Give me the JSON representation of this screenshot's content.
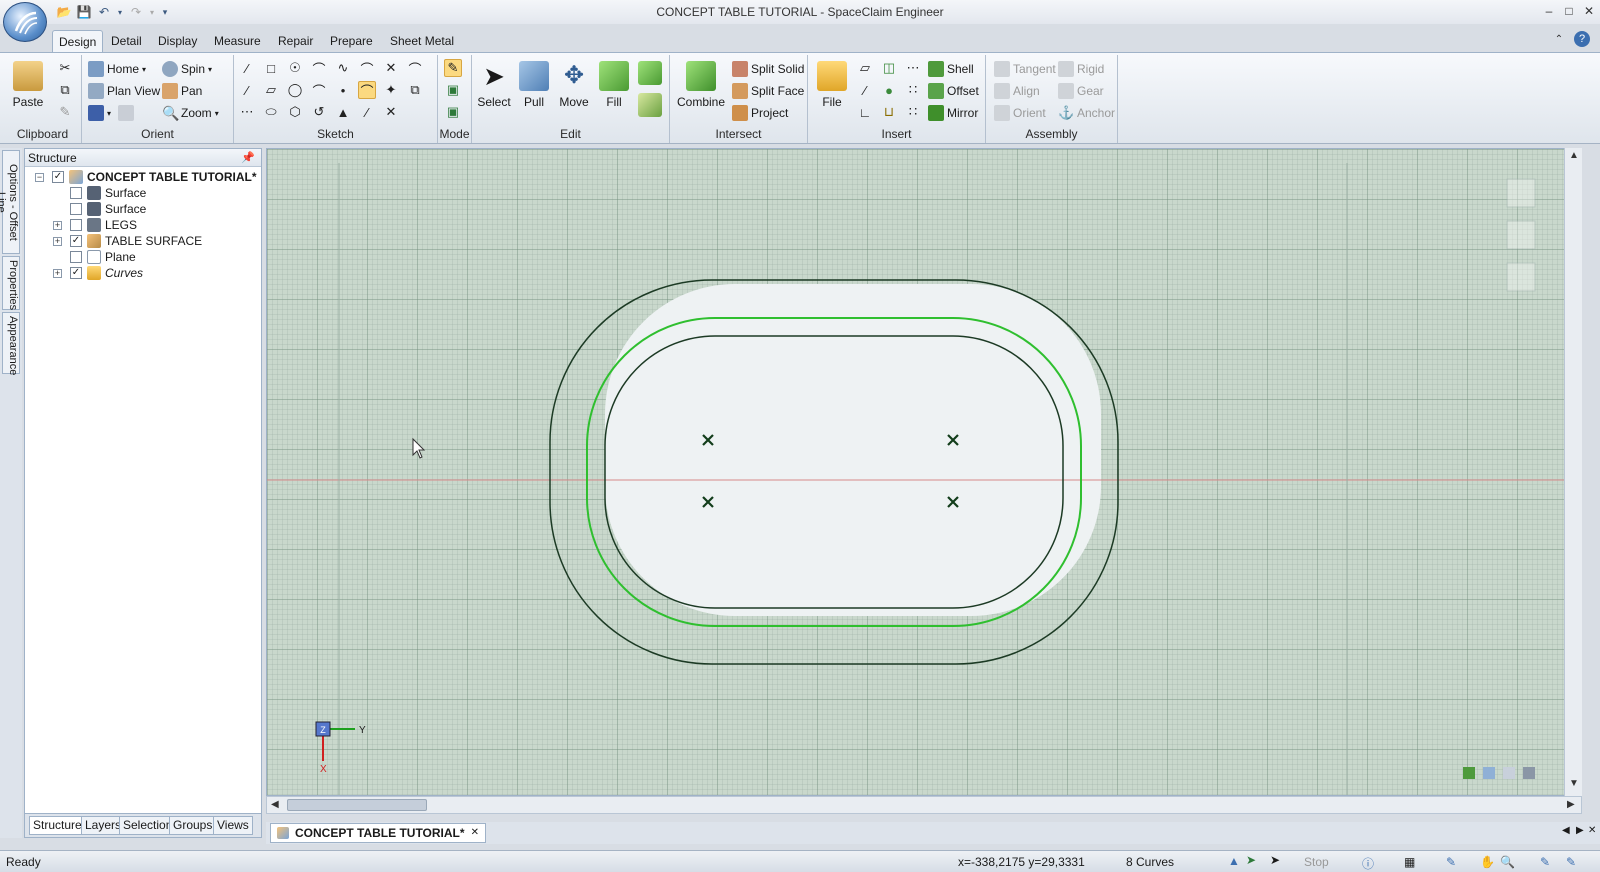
{
  "window": {
    "title": "CONCEPT TABLE TUTORIAL - SpaceClaim Engineer",
    "minimize": "–",
    "maximize": "□",
    "close": "✕"
  },
  "ribbon_tabs": [
    "Design",
    "Detail",
    "Display",
    "Measure",
    "Repair",
    "Prepare",
    "Sheet Metal"
  ],
  "ribbon": {
    "clipboard": {
      "label": "Clipboard",
      "paste": "Paste"
    },
    "orient": {
      "label": "Orient",
      "home": "Home",
      "spin": "Spin",
      "plan_view": "Plan View",
      "pan": "Pan",
      "zoom": "Zoom"
    },
    "sketch": {
      "label": "Sketch"
    },
    "mode": {
      "label": "Mode"
    },
    "edit": {
      "label": "Edit",
      "select": "Select",
      "pull": "Pull",
      "move": "Move",
      "fill": "Fill"
    },
    "intersect": {
      "label": "Intersect",
      "combine": "Combine",
      "split_solid": "Split Solid",
      "split_face": "Split Face",
      "project": "Project"
    },
    "insert": {
      "label": "Insert",
      "file": "File",
      "shell": "Shell",
      "offset": "Offset",
      "mirror": "Mirror"
    },
    "assembly": {
      "label": "Assembly",
      "tangent": "Tangent",
      "rigid": "Rigid",
      "align": "Align",
      "gear": "Gear",
      "orient": "Orient",
      "anchor": "Anchor"
    }
  },
  "side_tabs": [
    "Options - Offset Line",
    "Properties",
    "Appearance"
  ],
  "structure": {
    "title": "Structure",
    "tree": [
      {
        "label": "CONCEPT TABLE TUTORIAL*",
        "checked": true,
        "expander": "−",
        "bold": true
      },
      {
        "label": "Surface",
        "checked": false,
        "expander": ""
      },
      {
        "label": "Surface",
        "checked": false,
        "expander": ""
      },
      {
        "label": "LEGS",
        "checked": false,
        "expander": "+"
      },
      {
        "label": "TABLE SURFACE",
        "checked": true,
        "expander": "+"
      },
      {
        "label": "Plane",
        "checked": false,
        "expander": ""
      },
      {
        "label": "Curves",
        "checked": true,
        "expander": "+",
        "italic": true
      }
    ],
    "panel_tabs": [
      "Structure",
      "Layers",
      "Selection",
      "Groups",
      "Views"
    ]
  },
  "viewport": {
    "axis_z": "Z",
    "axis_y": "Y",
    "axis_x": "X"
  },
  "document_tab": {
    "label": "CONCEPT TABLE TUTORIAL*",
    "close": "✕"
  },
  "status": {
    "state": "Ready",
    "coords": "x=-338,2175  y=29,3331",
    "selection": "8 Curves",
    "stop": "Stop"
  },
  "colors": {
    "selected_curve": "#2fbf2f",
    "curve": "#1c3a24",
    "grid_bg": "#c9d8cc",
    "accent": "#3c6fb0"
  }
}
